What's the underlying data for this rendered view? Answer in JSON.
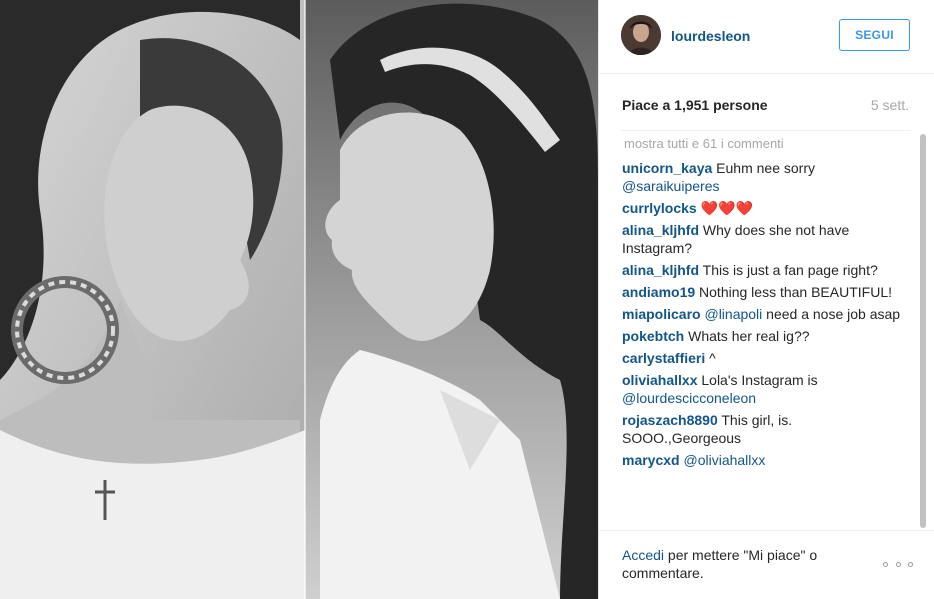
{
  "photo": {
    "icon": "photo-image",
    "description_icon": "split-portrait-photo"
  },
  "header": {
    "username": "lourdesleon",
    "follow_label": "SEGUI"
  },
  "stats": {
    "likes": "Piace a 1,951 persone",
    "time": "5 sett."
  },
  "comments": {
    "load_more": "mostra tutti e 61 i commenti",
    "items": [
      {
        "user": "unicorn_kaya",
        "text": " Euhm nee sorry ",
        "mention": "@saraikuiperes"
      },
      {
        "user": "currlylocks",
        "text": " ❤️❤️❤️",
        "mention": ""
      },
      {
        "user": "alina_kljhfd",
        "text": " Why does she not have Instagram?",
        "mention": ""
      },
      {
        "user": "alina_kljhfd",
        "text": " This is just a fan page right?",
        "mention": ""
      },
      {
        "user": "andiamo19",
        "text": " Nothing less than BEAUTIFUL!",
        "mention": ""
      },
      {
        "user": "miapolicaro",
        "text": " need a nose job asap",
        "mention": " @linapoli"
      },
      {
        "user": "pokebtch",
        "text": " Whats her real ig??",
        "mention": ""
      },
      {
        "user": "carlystaffieri",
        "text": " ^",
        "mention": ""
      },
      {
        "user": "oliviahallxx",
        "text": " Lola's Instagram is ",
        "mention": "@lourdescicconeleon"
      },
      {
        "user": "rojaszach8890",
        "text": " This girl, is. SOOO.,Georgeous",
        "mention": ""
      },
      {
        "user": "marycxd",
        "text": "",
        "mention": " @oliviahallxx"
      }
    ]
  },
  "footer": {
    "login_link": "Accedi",
    "login_text": " per mettere \"Mi piace\" o commentare."
  },
  "colors": {
    "link": "#125688",
    "button": "#3897f0",
    "muted": "#a5a7aa"
  }
}
